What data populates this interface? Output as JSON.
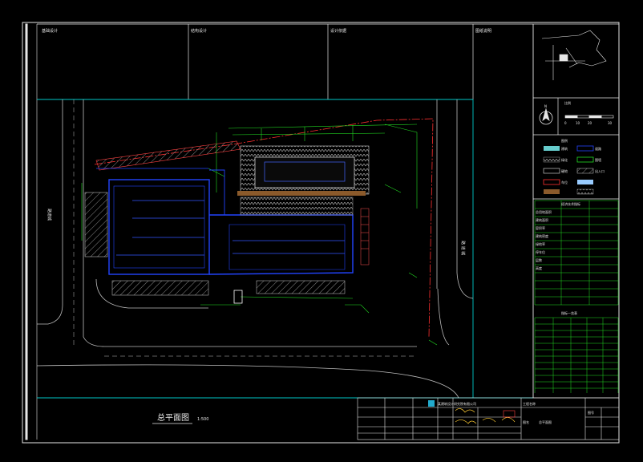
{
  "drawing": {
    "title_box_labels": [
      "基础设计",
      "结构设计",
      "设计依据",
      "图纸说明"
    ],
    "plan_title": "总平面图",
    "plan_scale": "1:500",
    "scale_bar_label": "比例",
    "scale_bar_ticks": [
      "0",
      "10",
      "20",
      "30"
    ],
    "north_label": "N",
    "road_label_east": "路 道 城",
    "road_label_west": "路道城"
  },
  "colors": {
    "background": "#000000",
    "frame": "#e6e6e6",
    "boundary": "#00c8c8",
    "building": "#2244ff",
    "red_line": "#ff3030",
    "green_line": "#22dd22",
    "road": "#bfbfbf",
    "hatch": "#7a7a7a",
    "brown": "#8b5a2b"
  },
  "legend": {
    "rows": [
      "图例",
      "建筑",
      "道路",
      "绿化",
      "围墙",
      "硬地",
      "出入口",
      "车位"
    ]
  },
  "tech_table": {
    "header": "经济技术指标",
    "rows": [
      "总用地面积",
      "建筑面积",
      "容积率",
      "建筑密度",
      "绿地率",
      "停车位",
      "层数",
      "高度"
    ],
    "sub_header": "指标一览表"
  },
  "title_block": {
    "company": "某建筑设计研究院有限公司",
    "project_label": "工程名称",
    "drawing_label": "图名",
    "drawing_name": "总平面图",
    "sheet_label": "图号"
  }
}
